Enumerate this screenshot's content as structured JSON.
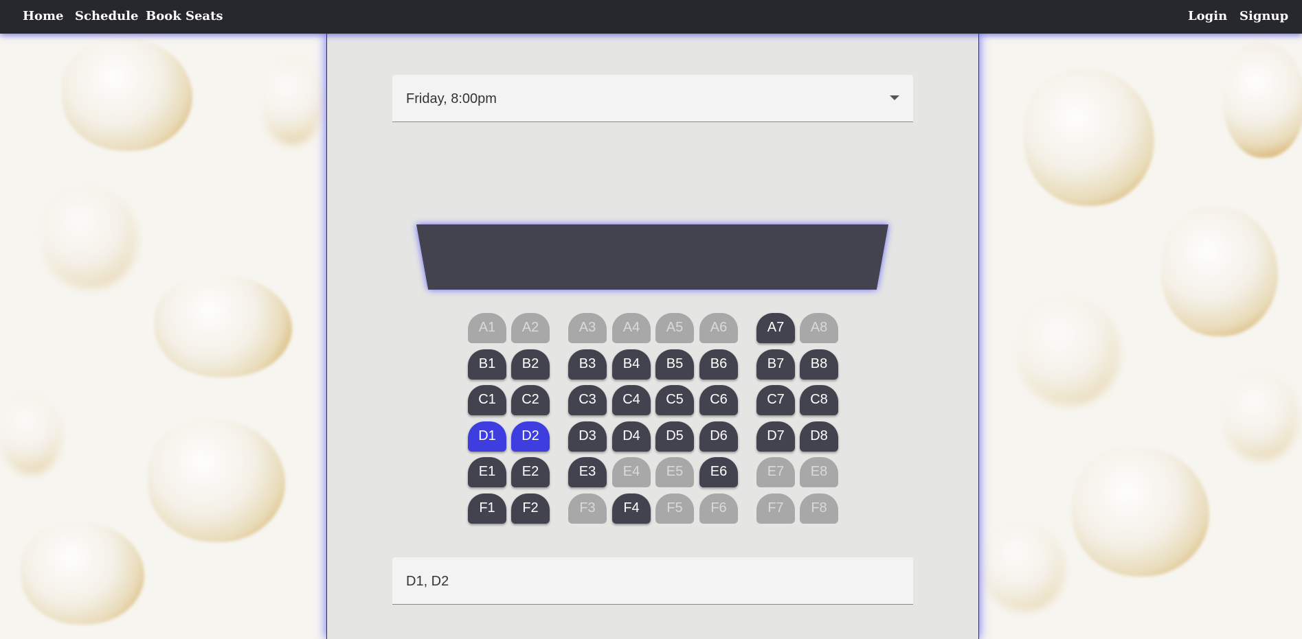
{
  "nav": {
    "left": [
      "Home",
      "Schedule",
      "Book Seats"
    ],
    "right": [
      "Login",
      "Signup"
    ]
  },
  "showtime": {
    "selected": "Friday, 8:00pm"
  },
  "screen": {
    "icon": "theater-screen"
  },
  "seat_states": {
    "available": "#43434f",
    "taken": "#a8a8a8",
    "selected": "#3e3ee0"
  },
  "rows": [
    {
      "row": "A",
      "seats": [
        {
          "label": "A1",
          "status": "taken"
        },
        {
          "label": "A2",
          "status": "taken"
        },
        {
          "label": "A3",
          "status": "taken"
        },
        {
          "label": "A4",
          "status": "taken"
        },
        {
          "label": "A5",
          "status": "taken"
        },
        {
          "label": "A6",
          "status": "taken"
        },
        {
          "label": "A7",
          "status": "available"
        },
        {
          "label": "A8",
          "status": "taken"
        }
      ]
    },
    {
      "row": "B",
      "seats": [
        {
          "label": "B1",
          "status": "available"
        },
        {
          "label": "B2",
          "status": "available"
        },
        {
          "label": "B3",
          "status": "available"
        },
        {
          "label": "B4",
          "status": "available"
        },
        {
          "label": "B5",
          "status": "available"
        },
        {
          "label": "B6",
          "status": "available"
        },
        {
          "label": "B7",
          "status": "available"
        },
        {
          "label": "B8",
          "status": "available"
        }
      ]
    },
    {
      "row": "C",
      "seats": [
        {
          "label": "C1",
          "status": "available"
        },
        {
          "label": "C2",
          "status": "available"
        },
        {
          "label": "C3",
          "status": "available"
        },
        {
          "label": "C4",
          "status": "available"
        },
        {
          "label": "C5",
          "status": "available"
        },
        {
          "label": "C6",
          "status": "available"
        },
        {
          "label": "C7",
          "status": "available"
        },
        {
          "label": "C8",
          "status": "available"
        }
      ]
    },
    {
      "row": "D",
      "seats": [
        {
          "label": "D1",
          "status": "selected"
        },
        {
          "label": "D2",
          "status": "selected"
        },
        {
          "label": "D3",
          "status": "available"
        },
        {
          "label": "D4",
          "status": "available"
        },
        {
          "label": "D5",
          "status": "available"
        },
        {
          "label": "D6",
          "status": "available"
        },
        {
          "label": "D7",
          "status": "available"
        },
        {
          "label": "D8",
          "status": "available"
        }
      ]
    },
    {
      "row": "E",
      "seats": [
        {
          "label": "E1",
          "status": "available"
        },
        {
          "label": "E2",
          "status": "available"
        },
        {
          "label": "E3",
          "status": "available"
        },
        {
          "label": "E4",
          "status": "taken"
        },
        {
          "label": "E5",
          "status": "taken"
        },
        {
          "label": "E6",
          "status": "available"
        },
        {
          "label": "E7",
          "status": "taken"
        },
        {
          "label": "E8",
          "status": "taken"
        }
      ]
    },
    {
      "row": "F",
      "seats": [
        {
          "label": "F1",
          "status": "available"
        },
        {
          "label": "F2",
          "status": "available"
        },
        {
          "label": "F3",
          "status": "taken"
        },
        {
          "label": "F4",
          "status": "available"
        },
        {
          "label": "F5",
          "status": "taken"
        },
        {
          "label": "F6",
          "status": "taken"
        },
        {
          "label": "F7",
          "status": "taken"
        },
        {
          "label": "F8",
          "status": "taken"
        }
      ]
    }
  ],
  "selection": {
    "value": "D1, D2"
  }
}
